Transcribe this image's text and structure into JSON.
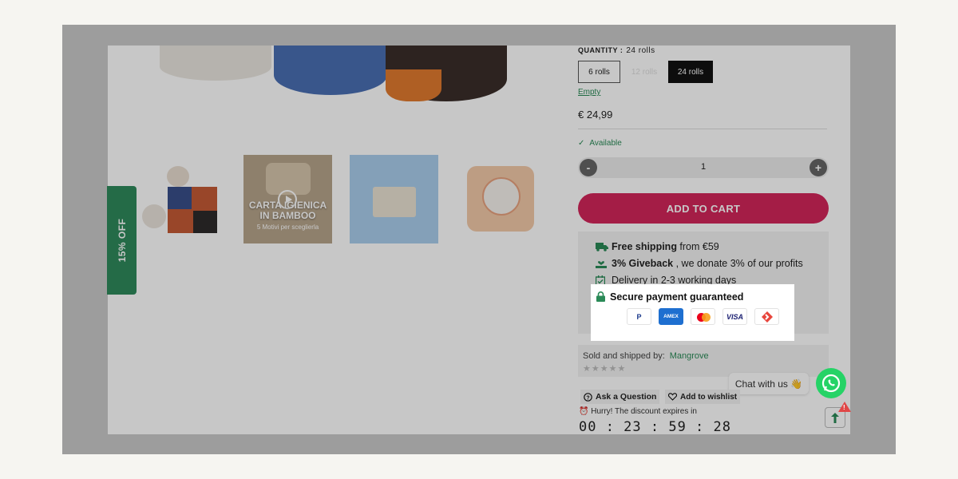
{
  "promo": {
    "discount_tab": "15% OFF"
  },
  "gallery": {
    "video_thumb_title": "CARTA IGIENICA IN BAMBOO",
    "video_thumb_subtitle": "5 Motivi per sceglierla"
  },
  "quantity": {
    "label": "QUANTITY :",
    "selected": "24 rolls",
    "options": [
      "6 rolls",
      "12 rolls",
      "24 rolls"
    ],
    "empty_link": "Empty"
  },
  "price": "€ 24,99",
  "availability": "Available",
  "stepper": {
    "minus": "-",
    "value": "1",
    "plus": "+"
  },
  "add_to_cart": "ADD TO CART",
  "perks": {
    "shipping_bold": "Free shipping",
    "shipping_rest": " from €59",
    "giveback_bold": "3% Giveback",
    "giveback_rest": " , we donate 3% of our profits",
    "delivery": "Delivery in 2-3 working days",
    "secure": "Secure payment guaranteed"
  },
  "payment_methods": {
    "paypal": "P",
    "amex": "AMEX",
    "visa": "VISA"
  },
  "seller": {
    "label": "Sold and shipped by:",
    "name": "Mangrove",
    "stars": "★★★★★"
  },
  "chat": {
    "label": "Chat with us 👋"
  },
  "actions": {
    "ask": "Ask a Question",
    "wishlist": "Add to wishlist"
  },
  "countdown": {
    "message": "Hurry! The discount expires in",
    "display": "00 : 23 :  59  :  28"
  },
  "colors": {
    "accent": "#d3265a",
    "green": "#2a8a57",
    "whatsapp": "#25d366"
  },
  "icons": [
    "truck-icon",
    "hand-heart-icon",
    "calendar-check-icon",
    "lock-icon",
    "check-icon",
    "question-icon",
    "heart-icon",
    "alarm-icon",
    "whatsapp-icon",
    "arrow-up-icon",
    "warning-icon",
    "play-icon"
  ]
}
